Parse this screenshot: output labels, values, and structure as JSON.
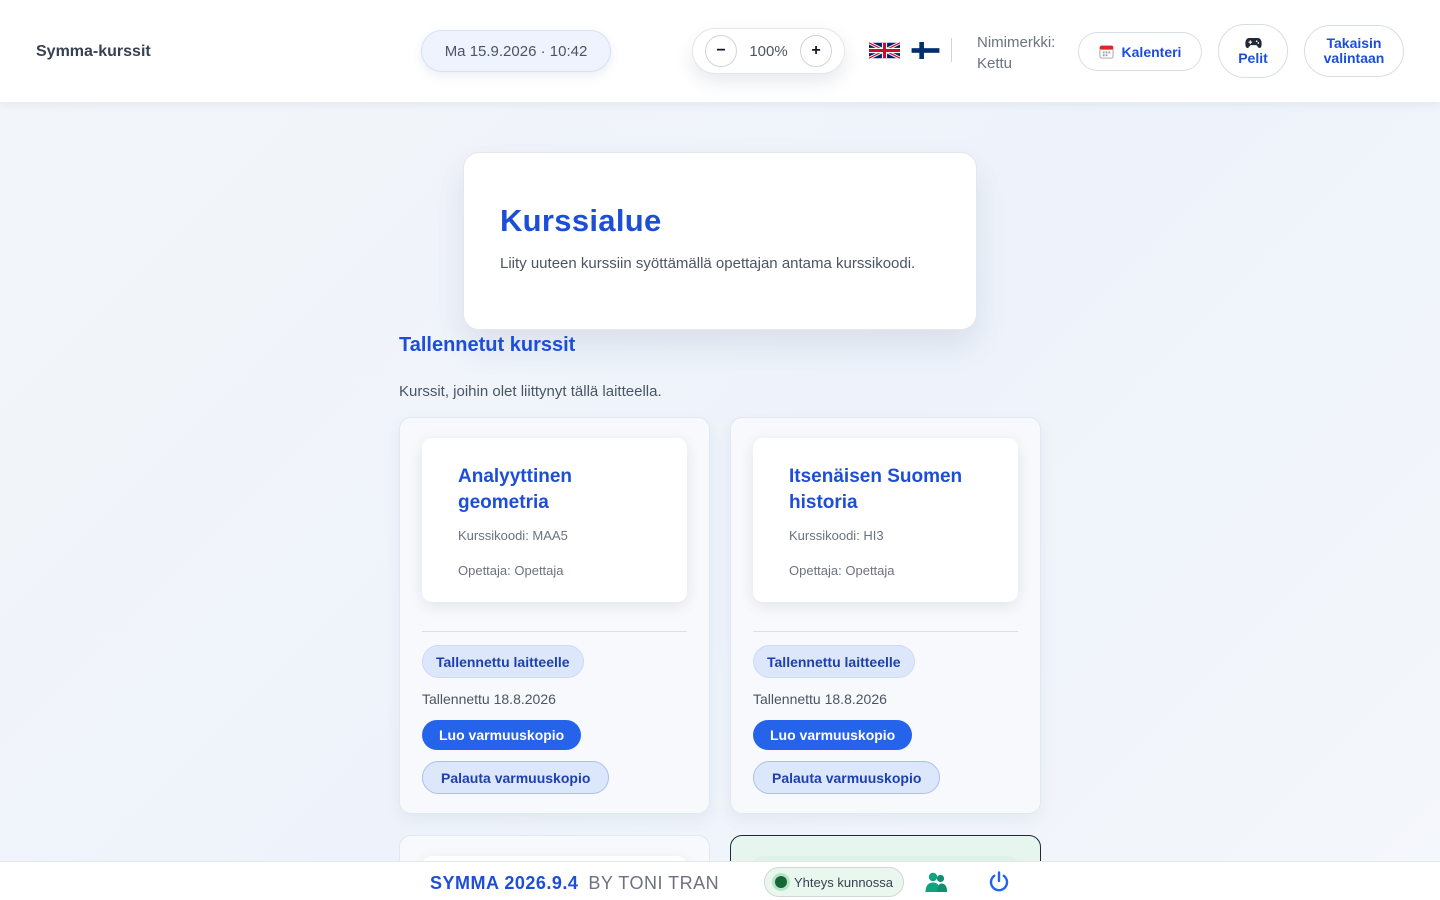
{
  "header": {
    "app_title": "Symma-kurssit",
    "datetime": "Ma 15.9.2026 · 10:42",
    "zoom": {
      "minus": "−",
      "value": "100%",
      "plus": "+"
    },
    "languages": [
      {
        "code": "en",
        "icon": "uk-flag-icon"
      },
      {
        "code": "fi",
        "icon": "finland-flag-icon"
      }
    ],
    "nickname_label": "Nimimerkki:",
    "nickname_value": "Kettu",
    "calendar_label": "Kalenteri",
    "games_label": "Pelit",
    "back_label": "Takaisin valintaan"
  },
  "hero": {
    "title": "Kurssialue",
    "description": "Liity uuteen kurssiin syöttämällä opettajan antama kurssikoodi."
  },
  "saved_courses": {
    "title": "Tallennetut kurssit",
    "subtitle": "Kurssit, joihin olet liittynyt tällä laitteella.",
    "courses": [
      {
        "name": "Analyyttinen geometria",
        "code": "Kurssikoodi: MAA5",
        "teacher": "Opettaja: Opettaja",
        "badge": "Tallennettu laitteelle",
        "saved_date": "Tallennettu 18.8.2026",
        "backup_label": "Luo varmuuskopio",
        "restore_label": "Palauta varmuuskopio"
      },
      {
        "name": "Itsenäisen Suomen historia",
        "code": "Kurssikoodi: HI3",
        "teacher": "Opettaja: Opettaja",
        "badge": "Tallennettu laitteelle",
        "saved_date": "Tallennettu 18.8.2026",
        "backup_label": "Luo varmuuskopio",
        "restore_label": "Palauta varmuuskopio"
      }
    ]
  },
  "footer": {
    "version": "SYMMA 2026.9.4",
    "author": "BY TONI TRAN",
    "status": "Yhteys kunnossa",
    "colors": {
      "accent": "#1d4ed8",
      "button": "#2563eb",
      "status_dot": "#166534",
      "users_icon": "#10a37f"
    }
  }
}
